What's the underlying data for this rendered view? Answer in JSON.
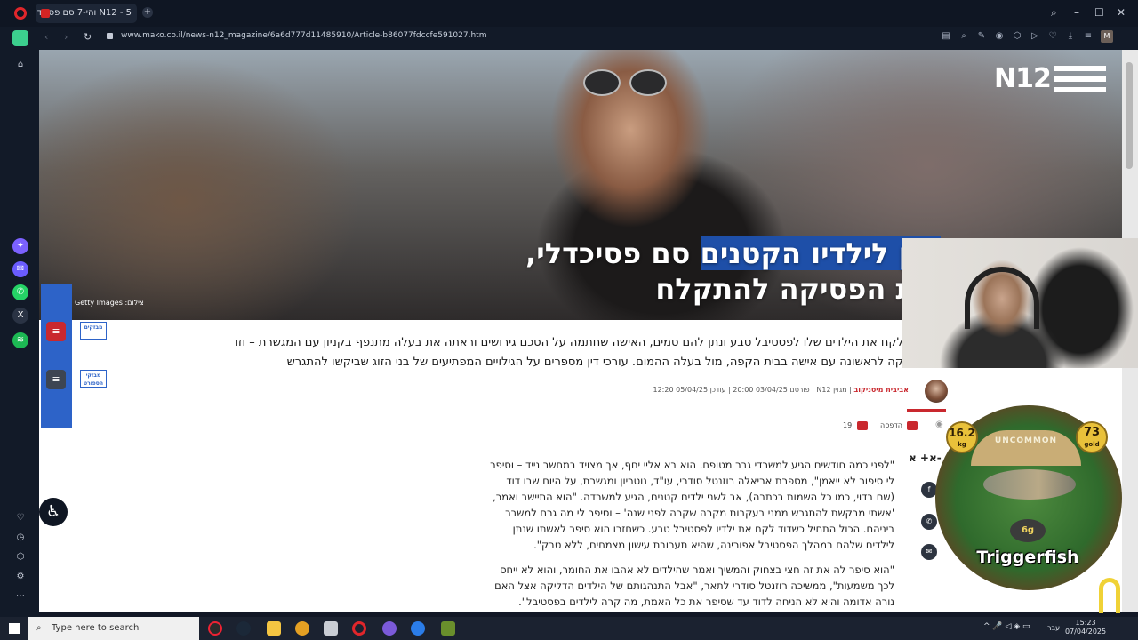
{
  "browser": {
    "tab_title": "N12 - 5 והי-7 סם פסיכדלי",
    "url": "www.mako.co.il/news-n12_magazine/6a6d777d11485910/Article-b86077fdccfe591027.htm",
    "profile_letter": "M"
  },
  "article": {
    "logo": "N12",
    "headline_line1_plain": "נתן לילדיו הקטנים סם פסיכדלי,",
    "headline_line1_highlight": "נתן לילדיו הקטנים",
    "headline_line1_rest": " סם פסיכדלי,",
    "headline_line2": "רית הפסיקה להתקלח",
    "photo_credit": "צילום: Getty Images",
    "subline1": "לקח את הילדים שלו לפסטיבל טבע ונתן להם סמים, האישה שחתמה על הסכם גירושים וראתה את בעלה מתנפף בקניון עם המגשרת – וזו",
    "subline2": "קה לראשונה עם אישה בבית הקפה, מול בעלה ההמום. עורכי דין מספרים על הגילויים המפתיעים של בני הזוג שביקשו להתגרש",
    "author": "אביבית מיסניקוב",
    "meta_rest": " | מגזין N12 | פורסם 03/04/25 20:00 | עודכן 05/04/25 12:20",
    "print_label": "הדפסה",
    "comments_count": "19",
    "font_size_label": "א+ א-",
    "paragraph1": "\"לפני כמה חודשים הגיע למשרדי גבר מטופח. הוא בא אליי יחף, אך מצויד במחשב נייד – וסיפר לי סיפור לא ייאמן\", מספרת אריאלה רוזנטל סודרי, עו\"ד, נוטריון ומגשרת, על היום שבו דוד (שם בדוי, כמו כל השמות בכתבה), אב לשני ילדים קטנים, הגיע למשרדה. \"הוא התיישב ואמר, 'אשתי מבקשת להתגרש ממני בעקבות מקרה שקרה לפני שנה' – וסיפר לי מה גרם למשבר ביניהם. הכול התחיל כשדוד לקח את ילדיו לפסטיבל טבע. כשחזרו הוא סיפר לאשתו שנתן לילדים שלהם במהלך הפסטיבל אפורינה, שהיא תערובת עישון מצמחים, ללא טבק\".",
    "paragraph2": "\"הוא סיפר לה את זה חצי בצחוק והמשיך ואמר שהילדים לא אהבו את החומר, והוא לא ייחס לכך משמעות\", ממשיכה רוזנטל סודרי לתאר, \"אבל התנהגותם של הילדים הדליקה אצל האם נורה אדומה והיא לא הניחה לדוד עד שסיפר את כל האמת, מה קרה לילדים בפסטיבל\"."
  },
  "sidebar_badges": {
    "badge1": "מבזקים",
    "badge2": "מבזקי הספורט"
  },
  "game_overlay": {
    "rarity": "UNCOMMON",
    "weight": "16.2",
    "weight_unit": "kg",
    "gold": "73",
    "gold_unit": "gold",
    "price": "6g",
    "fish_name": "Triggerfish"
  },
  "taskbar": {
    "search_placeholder": "Type here to search",
    "time": "15:23",
    "date": "07/04/2025",
    "language": "עבר"
  },
  "colors": {
    "accent_red": "#c9282e",
    "accent_blue": "#2d63c8",
    "headline_highlight": "#1e4fa8"
  }
}
